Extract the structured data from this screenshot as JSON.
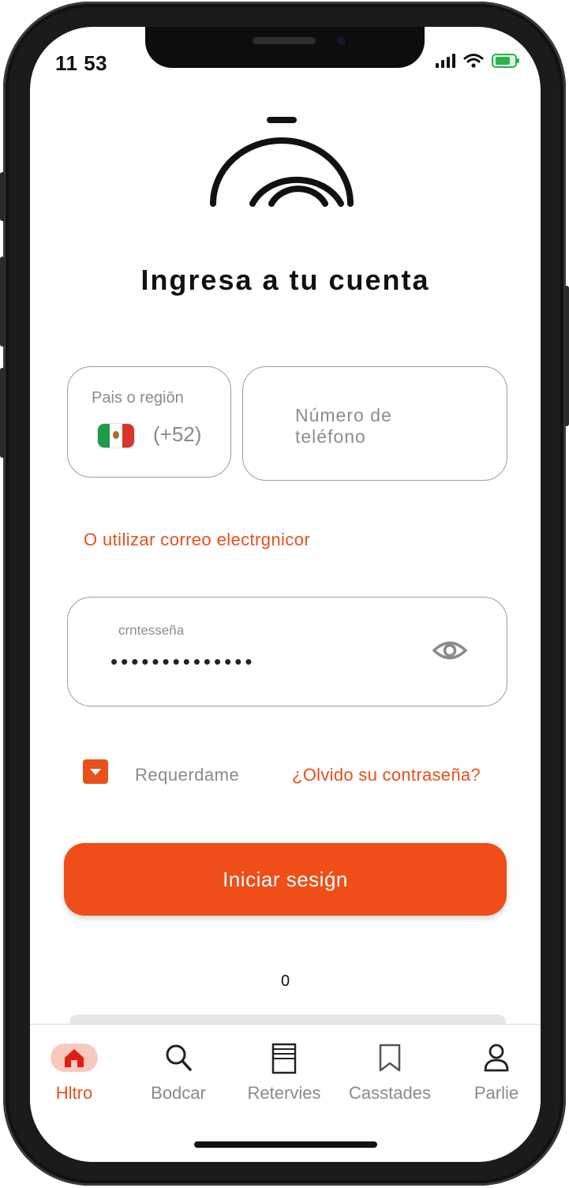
{
  "status_bar": {
    "time": "11 53"
  },
  "header": {
    "title": "Ingresa a tu cuenta"
  },
  "country_field": {
    "label": "Pais o regiōn",
    "dial_code": "(+52)",
    "flag": "mexico-flag"
  },
  "phone_field": {
    "placeholder": "Número de teléfono"
  },
  "email_link": {
    "label": "O utilizar correo electrgnicor"
  },
  "password_field": {
    "label": "crntesseña",
    "value": "••••••••••••••"
  },
  "remember": {
    "label": "Requerdame",
    "checked": true
  },
  "forgot_link": {
    "label": "¿Olvido su contraseña?"
  },
  "login_button": {
    "label": "Iniciar sesiǵn"
  },
  "counter": {
    "value": "0"
  },
  "tabbar": {
    "items": [
      {
        "label": "Hltro",
        "icon": "home-icon",
        "active": true
      },
      {
        "label": "Bodcar",
        "icon": "search-icon",
        "active": false
      },
      {
        "label": "Retervies",
        "icon": "receipt-icon",
        "active": false
      },
      {
        "label": "Casstades",
        "icon": "bookmark-icon",
        "active": false
      },
      {
        "label": "Parlie",
        "icon": "user-icon",
        "active": false
      }
    ]
  },
  "colors": {
    "accent": "#ef4e18",
    "link": "#e8501c",
    "tab_active_pill": "#f8c9c0",
    "battery": "#2bb24c"
  }
}
